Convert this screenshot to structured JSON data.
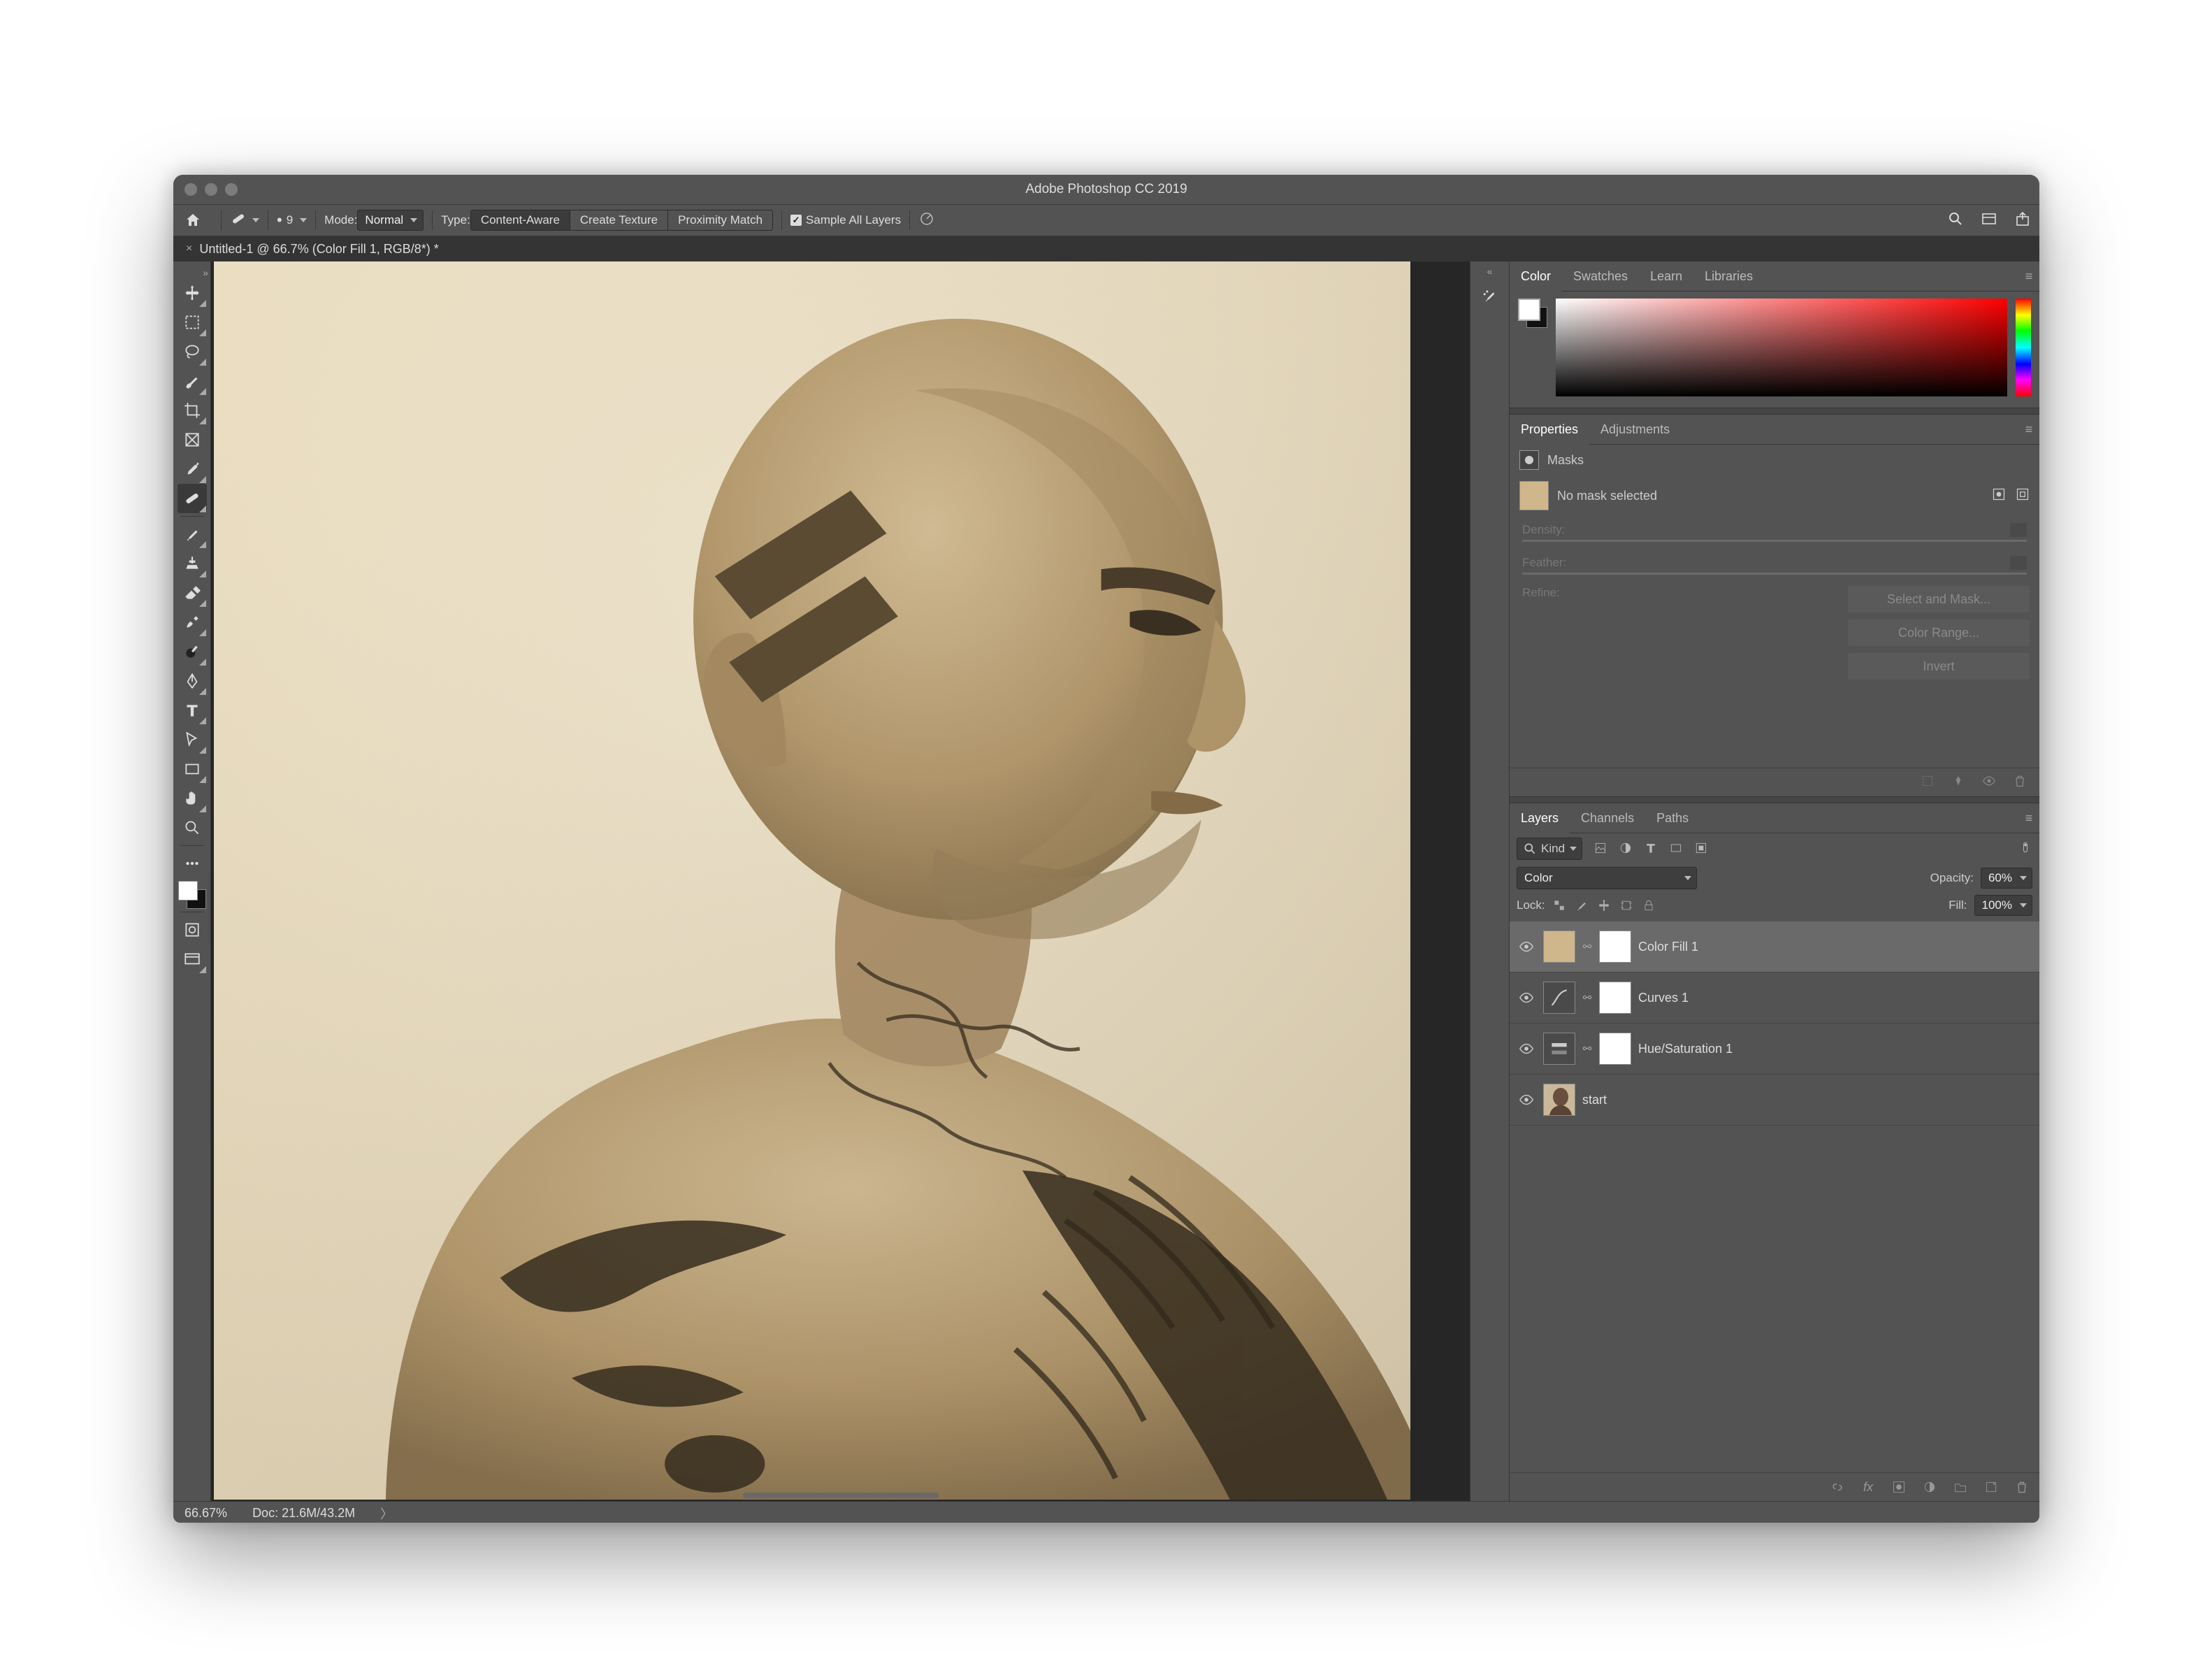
{
  "title": "Adobe Photoshop CC 2019",
  "options": {
    "brush_size": "9",
    "mode_label": "Mode:",
    "mode_value": "Normal",
    "type_label": "Type:",
    "type_content_aware": "Content-Aware",
    "type_create_texture": "Create Texture",
    "type_proximity_match": "Proximity Match",
    "sample_all": "Sample All Layers"
  },
  "document_tab": "Untitled-1 @ 66.7% (Color Fill 1, RGB/8*) *",
  "status": {
    "zoom": "66.67%",
    "doc": "Doc: 21.6M/43.2M"
  },
  "panel_tabs": {
    "color": "Color",
    "swatches": "Swatches",
    "learn": "Learn",
    "libraries": "Libraries",
    "properties": "Properties",
    "adjustments": "Adjustments",
    "layers": "Layers",
    "channels": "Channels",
    "paths": "Paths"
  },
  "properties": {
    "section_label": "Masks",
    "no_mask": "No mask selected",
    "density": "Density:",
    "feather": "Feather:",
    "refine": "Refine:",
    "btn_select_mask": "Select and Mask...",
    "btn_color_range": "Color Range...",
    "btn_invert": "Invert"
  },
  "layers_panel": {
    "kind_label": "Kind",
    "blend_mode": "Color",
    "opacity_label": "Opacity:",
    "opacity_value": "60%",
    "lock_label": "Lock:",
    "fill_label": "Fill:",
    "fill_value": "100%"
  },
  "layers": [
    {
      "name": "Color Fill 1",
      "selected": true,
      "type": "fill",
      "link": true
    },
    {
      "name": "Curves 1",
      "selected": false,
      "type": "adj",
      "link": true
    },
    {
      "name": "Hue/Saturation 1",
      "selected": false,
      "type": "adj",
      "link": true
    },
    {
      "name": "start",
      "selected": false,
      "type": "img",
      "link": false
    }
  ],
  "colors": {
    "fill_swatch": "#cfb68b"
  }
}
